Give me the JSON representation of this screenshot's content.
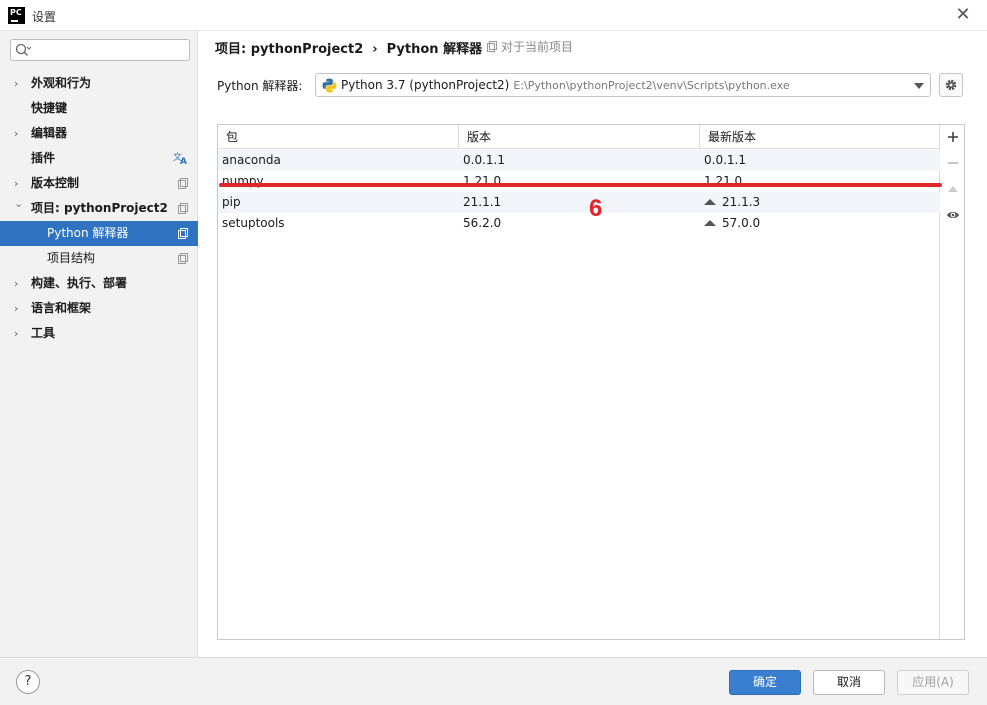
{
  "window": {
    "title": "设置",
    "logo": "PC"
  },
  "search": {
    "placeholder": ""
  },
  "sidebar": {
    "items": [
      {
        "label": "外观和行为"
      },
      {
        "label": "快捷键"
      },
      {
        "label": "编辑器"
      },
      {
        "label": "插件"
      },
      {
        "label": "版本控制"
      },
      {
        "label": "项目: pythonProject2"
      },
      {
        "label": "Python 解释器"
      },
      {
        "label": "项目结构"
      },
      {
        "label": "构建、执行、部署"
      },
      {
        "label": "语言和框架"
      },
      {
        "label": "工具"
      }
    ]
  },
  "breadcrumb": {
    "project": "项目: pythonProject2",
    "sep": "›",
    "page": "Python 解释器",
    "hint": "对于当前项目"
  },
  "interpreter": {
    "label": "Python 解释器:",
    "name": "Python 3.7 (pythonProject2)",
    "path": "E:\\Python\\pythonProject2\\venv\\Scripts\\python.exe"
  },
  "table": {
    "columns": [
      "包",
      "版本",
      "最新版本"
    ],
    "rows": [
      {
        "package": "anaconda",
        "version": "0.0.1.1",
        "latest": "0.0.1.1"
      },
      {
        "package": "numpy",
        "version": "1.21.0",
        "latest": "1.21.0"
      },
      {
        "package": "pip",
        "version": "21.1.1",
        "latest": "21.1.3"
      },
      {
        "package": "setuptools",
        "version": "56.2.0",
        "latest": "57.0.0"
      }
    ]
  },
  "annotation": {
    "text": "6",
    "color": "#e0252d"
  },
  "footer": {
    "help": "?",
    "ok": "确定",
    "cancel": "取消",
    "apply": "应用(A)"
  },
  "colors": {
    "accent": "#2f73c0",
    "ok_button": "#3a7ecf"
  }
}
